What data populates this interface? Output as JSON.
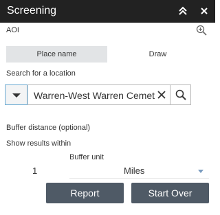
{
  "panel": {
    "title": "Screening"
  },
  "aoi": {
    "label": "AOI"
  },
  "tabs": [
    {
      "label": "Place name",
      "active": true
    },
    {
      "label": "Draw",
      "active": false
    }
  ],
  "search": {
    "label": "Search for a location",
    "value": "Warren-West Warren Cemetery, West Warren, MA, USA"
  },
  "buffer": {
    "distance_label": "Buffer distance (optional)",
    "show_results_label": "Show results within",
    "unit_label": "Buffer unit",
    "distance_value": "1",
    "unit_value": "Miles"
  },
  "actions": {
    "report_label": "Report",
    "start_over_label": "Start Over"
  },
  "colors": {
    "titlebar": "#222222",
    "button": "#4f5a66",
    "active_tab": "#e2e4e6",
    "dropdown_border": "#69a9d2"
  },
  "icons": {
    "collapse": "double-chevron-up-icon",
    "close": "close-icon",
    "zoom": "zoom-in-icon",
    "dropdown": "caret-down-icon",
    "clear": "clear-icon",
    "search": "search-icon"
  }
}
